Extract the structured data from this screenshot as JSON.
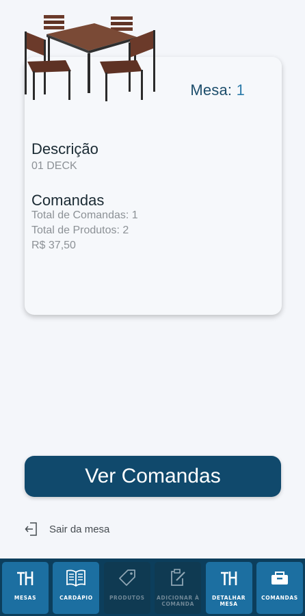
{
  "table": {
    "image_icon": "table-with-chairs-photo",
    "mesa_label": "Mesa:",
    "mesa_number": "1",
    "descricao_title": "Descrição",
    "descricao_value": "01 DECK",
    "comandas_title": "Comandas",
    "total_comandas": "Total de Comandas: 1",
    "total_produtos": "Total de Produtos: 2",
    "total_valor": "R$ 37,50"
  },
  "actions": {
    "ver_comandas": "Ver Comandas",
    "sair_mesa": "Sair da mesa",
    "sair_icon": "logout-icon"
  },
  "bottom_nav": {
    "items": [
      {
        "label": "MESAS",
        "icon": "table-icon",
        "state": "active"
      },
      {
        "label": "CARDÁPIO",
        "icon": "book-icon",
        "state": "active"
      },
      {
        "label": "PRODUTOS",
        "icon": "tag-icon",
        "state": "disabled"
      },
      {
        "label1": "ADICIONAR À",
        "label2": "COMANDA",
        "icon": "add-order-icon",
        "state": "disabled"
      },
      {
        "label1": "DETALHAR",
        "label2": "MESA",
        "icon": "table-icon",
        "state": "active"
      },
      {
        "label": "COMANDAS",
        "icon": "order-box-icon",
        "state": "active"
      }
    ]
  },
  "colors": {
    "primary": "#10496c",
    "nav_background": "#0c3e5c",
    "nav_active": "#1c6fa1",
    "accent_number": "#2c7ba9"
  }
}
